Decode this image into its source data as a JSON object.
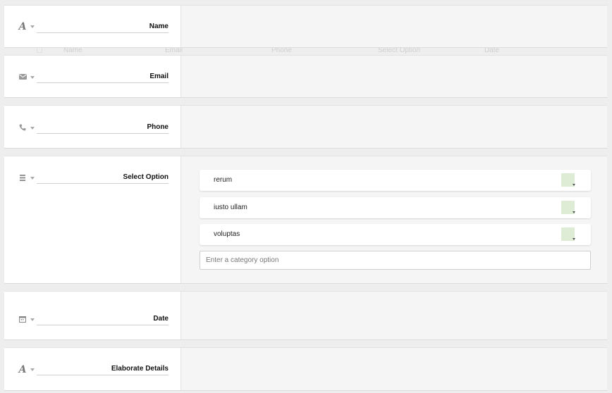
{
  "underlay_header": {
    "columns": [
      "Name",
      "Email",
      "Phone",
      "Select Option",
      "Date"
    ]
  },
  "fields": [
    {
      "key": "name",
      "label": "Name",
      "icon": "text-icon"
    },
    {
      "key": "email",
      "label": "Email",
      "icon": "envelope-icon"
    },
    {
      "key": "phone",
      "label": "Phone",
      "icon": "phone-icon"
    },
    {
      "key": "select",
      "label": "Select Option",
      "icon": "list-icon",
      "options": [
        {
          "label": "rerum",
          "color": "#deecd6"
        },
        {
          "label": "iusto ullam",
          "color": "#deecd6"
        },
        {
          "label": "voluptas",
          "color": "#deecd6"
        }
      ],
      "new_option_placeholder": "Enter a category option"
    },
    {
      "key": "date",
      "label": "Date",
      "icon": "calendar-icon"
    },
    {
      "key": "details",
      "label": "Elaborate Details",
      "icon": "text-icon"
    }
  ],
  "colors": {
    "panel_bg": "#ffffff",
    "config_bg": "#f5f5f5",
    "page_bg": "#eeeeee",
    "swatch": "#deecd6"
  }
}
